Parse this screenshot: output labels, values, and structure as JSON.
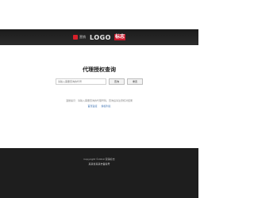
{
  "header": {
    "logo_cn": "营销",
    "logo_word": "LOGO",
    "logo_badge": "标志"
  },
  "main": {
    "title": "代理授权查询",
    "search_placeholder": "请输入需要查询的代号",
    "query_label": "查询",
    "reset_label": "重置",
    "note": "温馨提示：请输入需要查询的代理号码，查询后请注意核对结果",
    "links": [
      "首页链接",
      "授权列表"
    ]
  },
  "footer": {
    "copyright": "Copyright ©2019 营销标志",
    "beian": "某某省某某市备案号"
  },
  "colors": {
    "header_bg": "#222222",
    "brand_red": "#d6202a",
    "footer_bg": "#1e1e1e",
    "link_blue": "#3a6fb0"
  }
}
